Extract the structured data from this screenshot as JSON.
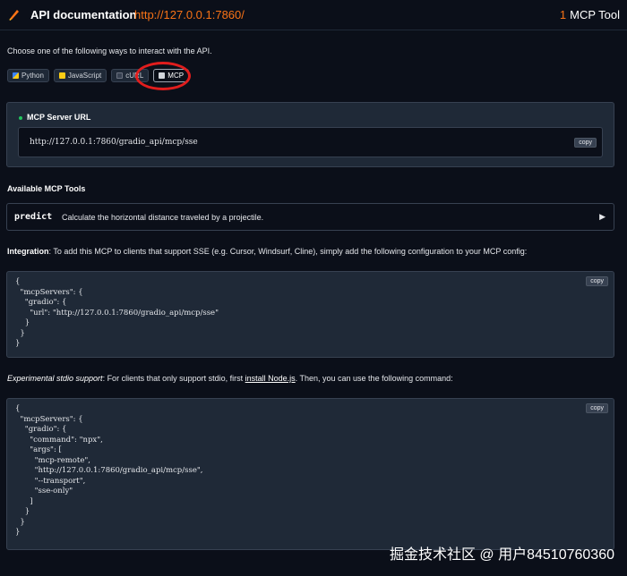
{
  "header": {
    "title": "API documentation",
    "url": "http://127.0.0.1:7860/",
    "tool_count": "1",
    "tool_label": "MCP Tool"
  },
  "intro": "Choose one of the following ways to interact with the API.",
  "tabs": [
    {
      "label": "Python",
      "icon": "python-icon"
    },
    {
      "label": "JavaScript",
      "icon": "javascript-icon"
    },
    {
      "label": "cURL",
      "icon": "curl-icon"
    },
    {
      "label": "MCP",
      "icon": "mcp-icon",
      "active": true
    }
  ],
  "mcp_server": {
    "label": "MCP Server URL",
    "url": "http://127.0.0.1:7860/gradio_api/mcp/sse",
    "copy_label": "copy"
  },
  "tools_section": {
    "title": "Available MCP Tools",
    "tools": [
      {
        "name": "predict",
        "description": "Calculate the horizontal distance traveled by a projectile."
      }
    ]
  },
  "integration": {
    "label": "Integration",
    "text": ": To add this MCP to clients that support SSE (e.g. Cursor, Windsurf, Cline), simply add the following configuration to your MCP config:",
    "code": "{\n  \"mcpServers\": {\n    \"gradio\": {\n      \"url\": \"http://127.0.0.1:7860/gradio_api/mcp/sse\"\n    }\n  }\n}",
    "copy_label": "copy"
  },
  "experimental": {
    "label": "Experimental stdio support",
    "text_before": ": For clients that only support stdio, first ",
    "link": "install Node.js",
    "text_after": ". Then, you can use the following command:",
    "code": "{\n  \"mcpServers\": {\n    \"gradio\": {\n      \"command\": \"npx\",\n      \"args\": [\n        \"mcp-remote\",\n        \"http://127.0.0.1:7860/gradio_api/mcp/sse\",\n        \"--transport\",\n        \"sse-only\"\n      ]\n    }\n  }\n}",
    "copy_label": "copy"
  },
  "watermark": "掘金技术社区 @ 用户84510760360",
  "colors": {
    "background": "#0b0f19",
    "accent": "#f97316",
    "highlight": "#e11d1d"
  }
}
